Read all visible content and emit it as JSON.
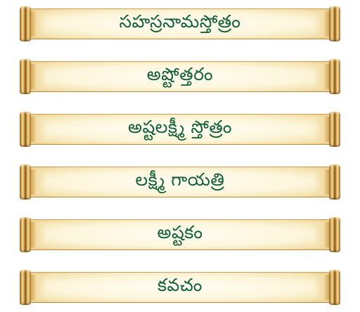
{
  "menu": {
    "items": [
      {
        "label": "సహస్రనామస్తోత్రం"
      },
      {
        "label": "అష్టోత్తరం"
      },
      {
        "label": "అష్టలక్ష్మీ స్తోత్రం"
      },
      {
        "label": "లక్ష్మీ గాయత్రి"
      },
      {
        "label": "అష్టకం"
      },
      {
        "label": "కవచం"
      }
    ]
  },
  "colors": {
    "label_text": "#15603a",
    "scroll_paper": "#fdf6dc",
    "scroll_roll": "#c99644"
  }
}
